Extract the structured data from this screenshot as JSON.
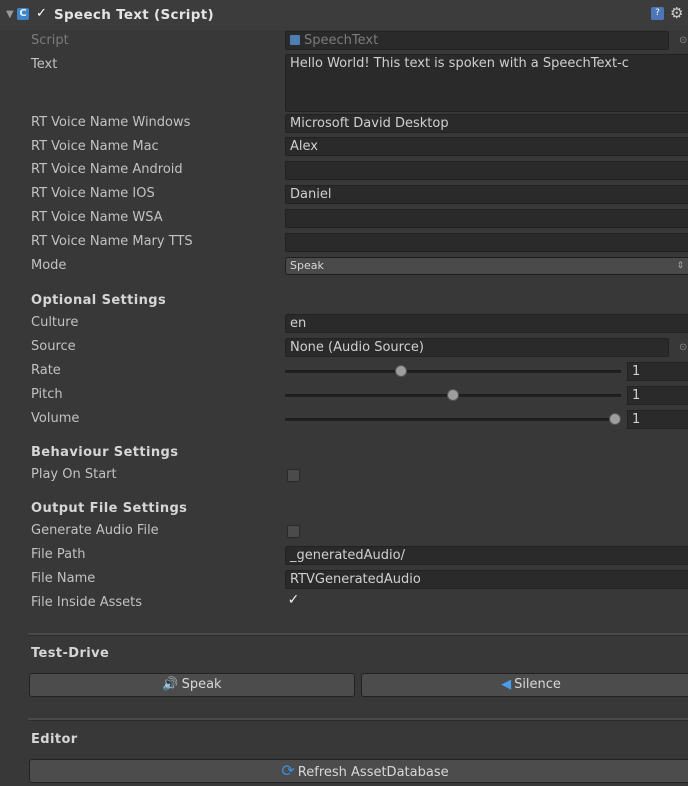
{
  "component": {
    "title": "Speech Text (Script)",
    "foldout_icon": "triangle-down-icon",
    "enabled_check": "✓",
    "help_icon": "?",
    "gear_icon": "⚙"
  },
  "fields": {
    "script": {
      "label": "Script",
      "value": "SpeechText"
    },
    "text": {
      "label": "Text",
      "value": "Hello World! This text is spoken with a SpeechText-c"
    },
    "voice_windows": {
      "label": "RT Voice Name Windows",
      "value": "Microsoft David Desktop"
    },
    "voice_mac": {
      "label": "RT Voice Name Mac",
      "value": "Alex"
    },
    "voice_android": {
      "label": "RT Voice Name Android",
      "value": ""
    },
    "voice_ios": {
      "label": "RT Voice Name IOS",
      "value": "Daniel"
    },
    "voice_wsa": {
      "label": "RT Voice Name WSA",
      "value": ""
    },
    "voice_mary": {
      "label": "RT Voice Name Mary TTS",
      "value": ""
    },
    "mode": {
      "label": "Mode",
      "value": "Speak"
    }
  },
  "optional": {
    "heading": "Optional Settings",
    "culture": {
      "label": "Culture",
      "value": "en"
    },
    "source": {
      "label": "Source",
      "value": "None (Audio Source)"
    },
    "rate": {
      "label": "Rate",
      "value": "1",
      "slider_fraction": 0.34
    },
    "pitch": {
      "label": "Pitch",
      "value": "1",
      "slider_fraction": 0.5
    },
    "volume": {
      "label": "Volume",
      "value": "1",
      "slider_fraction": 1.0
    }
  },
  "behaviour": {
    "heading": "Behaviour Settings",
    "play_on_start": {
      "label": "Play On Start",
      "checked": false
    }
  },
  "output": {
    "heading": "Output File Settings",
    "generate": {
      "label": "Generate Audio File",
      "checked": false
    },
    "file_path": {
      "label": "File Path",
      "value": "_generatedAudio/"
    },
    "file_name": {
      "label": "File Name",
      "value": "RTVGeneratedAudio"
    },
    "inside_assets": {
      "label": "File Inside Assets",
      "checked": true,
      "check_glyph": "✓"
    }
  },
  "test_drive": {
    "heading": "Test-Drive",
    "speak_label": "Speak",
    "speak_icon": "🔊",
    "silence_label": "Silence",
    "silence_icon": "◀"
  },
  "editor": {
    "heading": "Editor",
    "refresh_label": "Refresh AssetDatabase",
    "refresh_icon": "⟳"
  },
  "colors": {
    "background": "#383838",
    "field_bg": "#2a2a2a",
    "accent": "#3c8fe0"
  }
}
